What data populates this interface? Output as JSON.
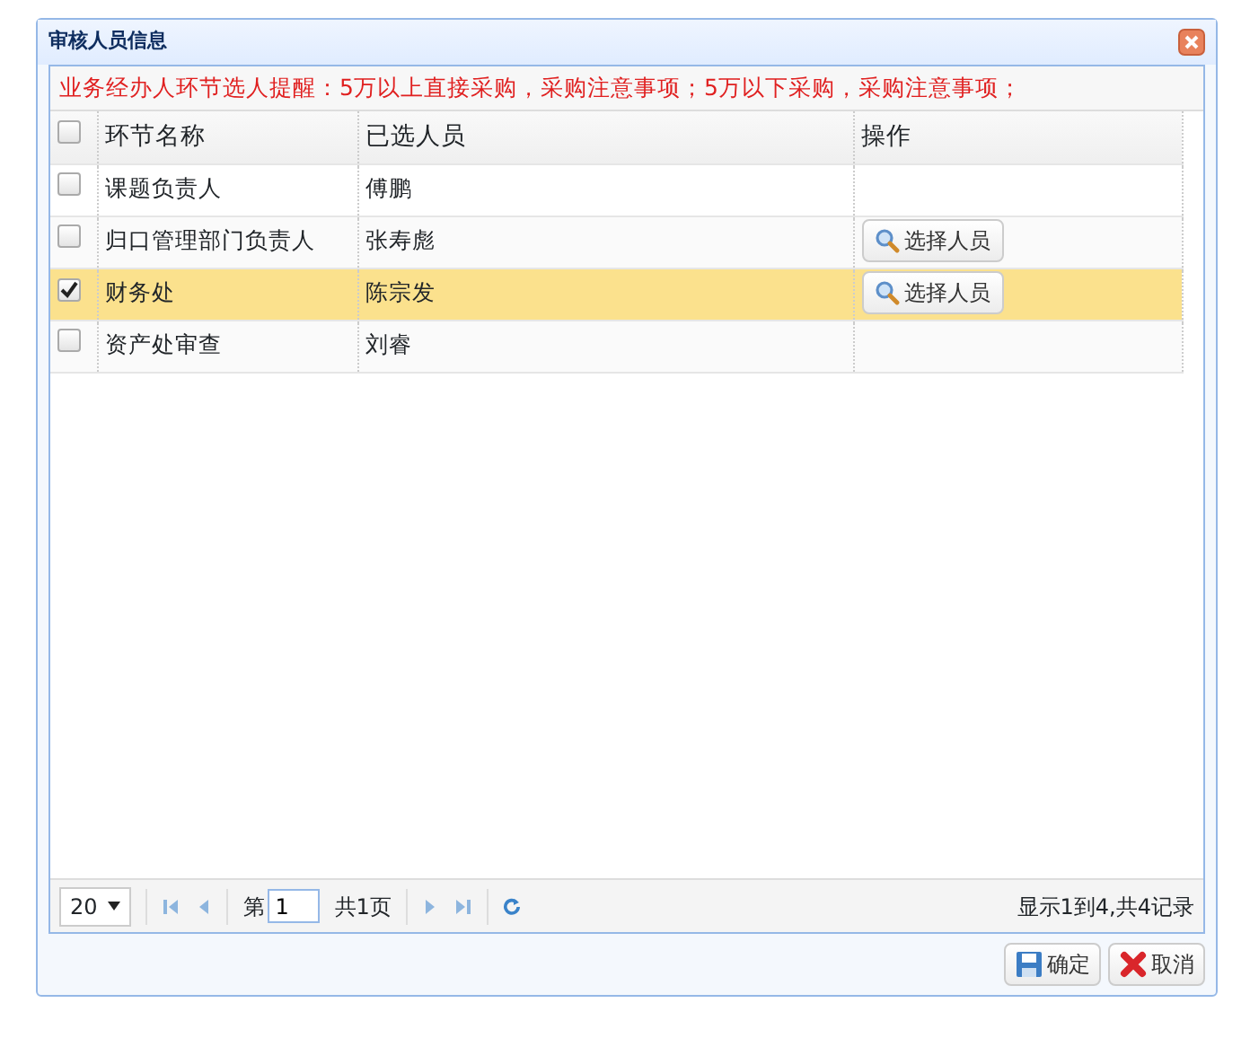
{
  "window": {
    "title": "审核人员信息"
  },
  "notice": "业务经办人环节选人提醒：5万以上直接采购，采购注意事项；5万以下采购，采购注意事项；",
  "table": {
    "header_checked": false,
    "columns": [
      {
        "label": "环节名称"
      },
      {
        "label": "已选人员"
      },
      {
        "label": "操作"
      }
    ],
    "rows": [
      {
        "checked": false,
        "selected": false,
        "name": "课题负责人",
        "person": "傅鹏"
      },
      {
        "checked": false,
        "selected": false,
        "name": "归口管理部门负责人",
        "person": "张寿彪",
        "action": "选择人员"
      },
      {
        "checked": true,
        "selected": true,
        "name": "财务处",
        "person": "陈宗发",
        "action": "选择人员"
      },
      {
        "checked": false,
        "selected": false,
        "name": "资产处审查",
        "person": "刘睿"
      }
    ]
  },
  "pager": {
    "page_size": "20",
    "page_prefix": "第",
    "page": "1",
    "page_suffix": "共1页",
    "summary": "显示1到4,共4记录"
  },
  "buttons": [
    {
      "kind": "save",
      "label": "确定"
    },
    {
      "kind": "cancel",
      "label": "取消"
    }
  ]
}
